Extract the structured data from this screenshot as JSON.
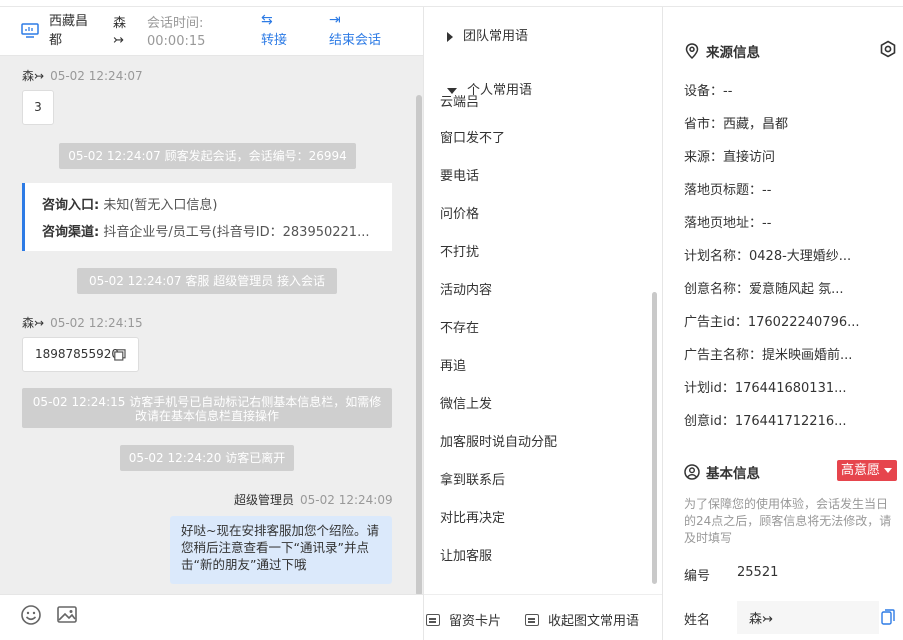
{
  "header": {
    "location": "西藏昌都",
    "user": "森↣",
    "session_time_label": "会话时间:",
    "session_time_value": "00:00:15",
    "transfer_label": "转接",
    "end_label": "结束会话"
  },
  "messages": {
    "m1_sender": "森↣",
    "m1_time": "05-02 12:24:07",
    "m1_text": "3",
    "sys1": "05-02 12:24:07 顾客发起会话，会话编号：26994",
    "card": {
      "entry_label": "咨询入口:",
      "entry_value": "未知(暂无入口信息)",
      "channel_label": "咨询渠道:",
      "channel_value": "抖音企业号/员工号(抖音号ID：283950221..."
    },
    "sys2": "05-02 12:24:07 客服 超级管理员 接入会话",
    "m2_sender": "森↣",
    "m2_time": "05-02 12:24:15",
    "m2_text": "18987855920",
    "sys3": "05-02 12:24:15 访客手机号已自动标记右侧基本信息栏，如需修改请在基本信息栏直接操作",
    "sys4": "05-02 12:24:20 访客已离开",
    "agent_name": "超级管理员",
    "agent_time": "05-02 12:24:09",
    "agent_text": "好哒~现在安排客服加您个绍险。请您稍后注意查看一下“通讯录”并点击“新的朋友”通过下哦"
  },
  "phrases": {
    "team_group": "团队常用语",
    "personal_group": "个人常用语",
    "cut_item": "云端吕",
    "items": [
      "窗口发不了",
      "要电话",
      "问价格",
      "不打扰",
      "活动内容",
      "不存在",
      "再追",
      "微信上发",
      "加客服时说自动分配",
      "拿到联系后",
      "对比再决定",
      "让加客服"
    ],
    "footer_card": "留资卡片",
    "footer_collapse": "收起图文常用语"
  },
  "source_info": {
    "title": "来源信息",
    "fields": [
      "设备：--",
      "省市：西藏，昌都",
      "来源：直接访问",
      "落地页标题：--",
      "落地页地址：--",
      "计划名称：0428-大理婚纱...",
      "创意名称：爱意随风起 氛...",
      "广告主id：176022240796...",
      "广告主名称：提米映画婚前...",
      "计划id：176441680131...",
      "创意id：176441712216..."
    ]
  },
  "basic_info": {
    "title": "基本信息",
    "intent": "高意愿",
    "note": "为了保障您的使用体验，会话发生当日的24点之后，顾客信息将无法修改，请及时填写",
    "id_label": "编号",
    "id_value": "25521",
    "name_label": "姓名",
    "name_value": "森↣"
  },
  "colors": {
    "accent": "#2d7be5",
    "intent": "#e6454d",
    "agent_bubble": "#dbe9fb"
  }
}
